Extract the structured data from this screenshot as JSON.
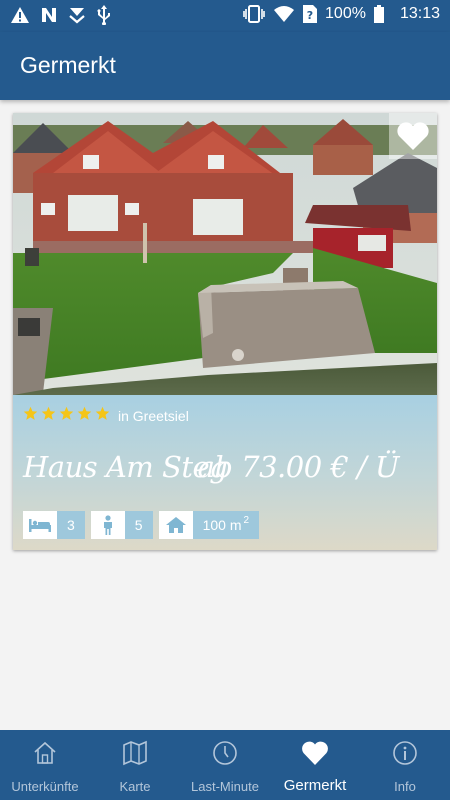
{
  "status_bar": {
    "battery": "100%",
    "time": "13:13"
  },
  "app_bar": {
    "title": "Germerkt"
  },
  "listing": {
    "rating": 5,
    "location": "in Greetsiel",
    "name": "Haus Am Steg",
    "price": "ab 73.00 € / Ü",
    "bedrooms": "3",
    "persons": "5",
    "area": "100 m",
    "area_unit_sup": "2",
    "favorite_icon": "heart-icon"
  },
  "bottom_nav": {
    "items": [
      {
        "label": "Unterkünfte",
        "icon": "house-icon"
      },
      {
        "label": "Karte",
        "icon": "map-icon"
      },
      {
        "label": "Last-Minute",
        "icon": "clock-icon"
      },
      {
        "label": "Germerkt",
        "icon": "heart-icon"
      },
      {
        "label": "Info",
        "icon": "info-icon"
      }
    ],
    "active_index": 3
  },
  "colors": {
    "primary": "#245a8e",
    "star": "#f5c518",
    "feature_value_bg": "#9ec8dc"
  }
}
